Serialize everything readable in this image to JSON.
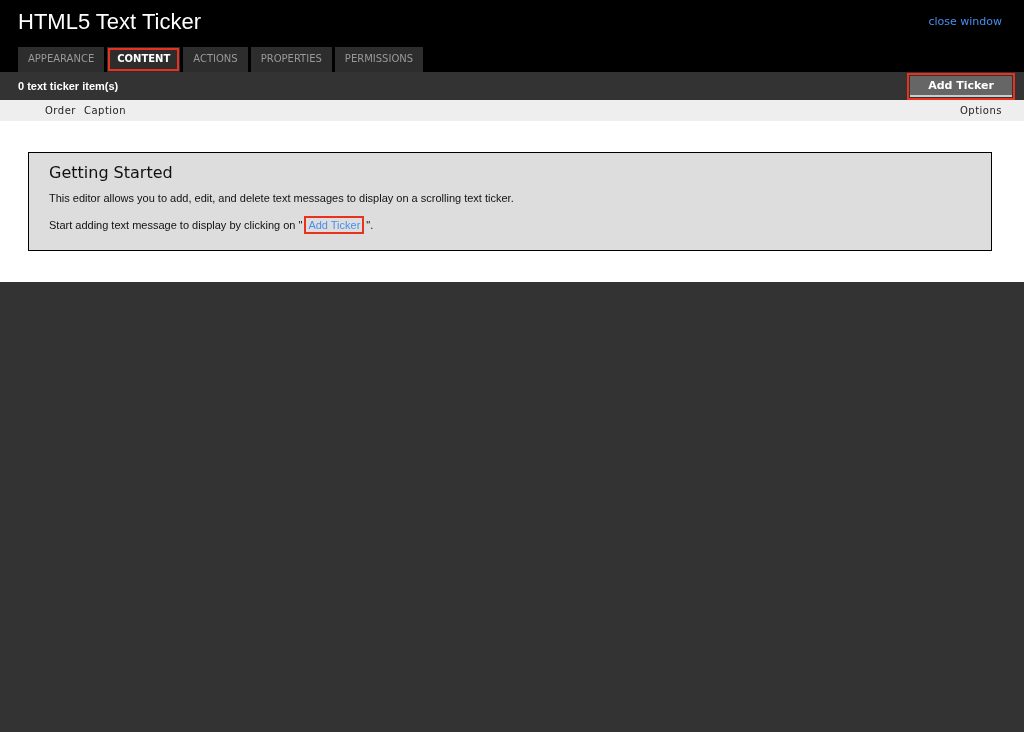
{
  "window": {
    "title": "HTML5 Text Ticker",
    "close_link": "close window"
  },
  "tabs": [
    {
      "label": "APPEARANCE",
      "selected": false,
      "highlighted": false
    },
    {
      "label": "CONTENT",
      "selected": true,
      "highlighted": true
    },
    {
      "label": "ACTIONS",
      "selected": false,
      "highlighted": false
    },
    {
      "label": "PROPERTIES",
      "selected": false,
      "highlighted": false
    },
    {
      "label": "PERMISSIONS",
      "selected": false,
      "highlighted": false
    }
  ],
  "toolbar": {
    "count": "0 text ticker item(s)",
    "button": {
      "label": "Add Ticker",
      "highlighted": true
    }
  },
  "table": {
    "columns": [
      "Order",
      "Caption"
    ],
    "options_column": "Options"
  },
  "panel": {
    "title": "Getting Started",
    "text": "This editor allows you to add, edit, and delete text messages to display on a scrolling text ticker.",
    "prompt_before": "Start adding text message to display by clicking on \"",
    "link": {
      "label": "Add Ticker",
      "highlighted": true
    },
    "prompt_after": "\"."
  }
}
